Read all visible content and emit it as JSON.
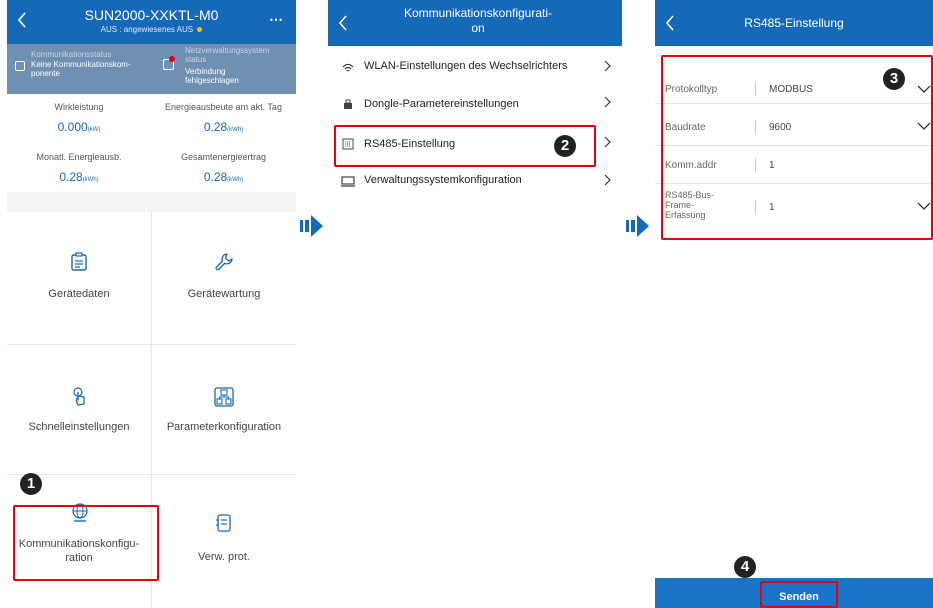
{
  "screen1": {
    "title": "SUN2000-XXKTL-M0",
    "subtitle": "AUS : angewiesenes AUS",
    "comm_status_label": "Kommunikationsstatus",
    "comm_status_value": "Keine Kommunikationskom-ponente",
    "grid_status_label": "Netzverwaltungssystem status",
    "grid_status_value": "Verbindung fehlgeschlagen",
    "stats": [
      {
        "label": "Wirkleistung",
        "value": "0.000",
        "unit": "(kW)"
      },
      {
        "label": "Energieausbeute am akt. Tag",
        "value": "0.28",
        "unit": "(kWh)"
      },
      {
        "label": "Monatl. Energieausb.",
        "value": "0.28",
        "unit": "(kWh)"
      },
      {
        "label": "Gesamtenergieertrag",
        "value": "0.28",
        "unit": "(kWh)"
      }
    ],
    "tiles": [
      {
        "label": "Gerätedaten"
      },
      {
        "label": "Gerätewartung"
      },
      {
        "label": "Schnelleinstellungen"
      },
      {
        "label": "Parameterkonfiguration"
      },
      {
        "label": "Kommunikationskonfigu-ration"
      },
      {
        "label": "Verw. prot."
      }
    ],
    "step": "1"
  },
  "screen2": {
    "title": "Kommunikationskonfigurati-on",
    "items": [
      {
        "label": "WLAN-Einstellungen des Wechselrichters"
      },
      {
        "label": "Dongle-Parametereinstellungen"
      },
      {
        "label": "RS485-Einstellung"
      },
      {
        "label": "Verwaltungssystemkonfiguration"
      }
    ],
    "step": "2"
  },
  "screen3": {
    "title": "RS485-Einstellung",
    "fields": [
      {
        "label": "Protokolltyp",
        "value": "MODBUS"
      },
      {
        "label": "Baudrate",
        "value": "9600"
      },
      {
        "label": "Komm.addr",
        "value": "1"
      },
      {
        "label": "RS485-Bus-Frame-Erfassung",
        "value": "1"
      }
    ],
    "send_label": "Senden",
    "step3": "3",
    "step4": "4"
  },
  "colors": {
    "header": "#1668b8",
    "highlight": "#e60012",
    "arrow": "#1668b8"
  }
}
